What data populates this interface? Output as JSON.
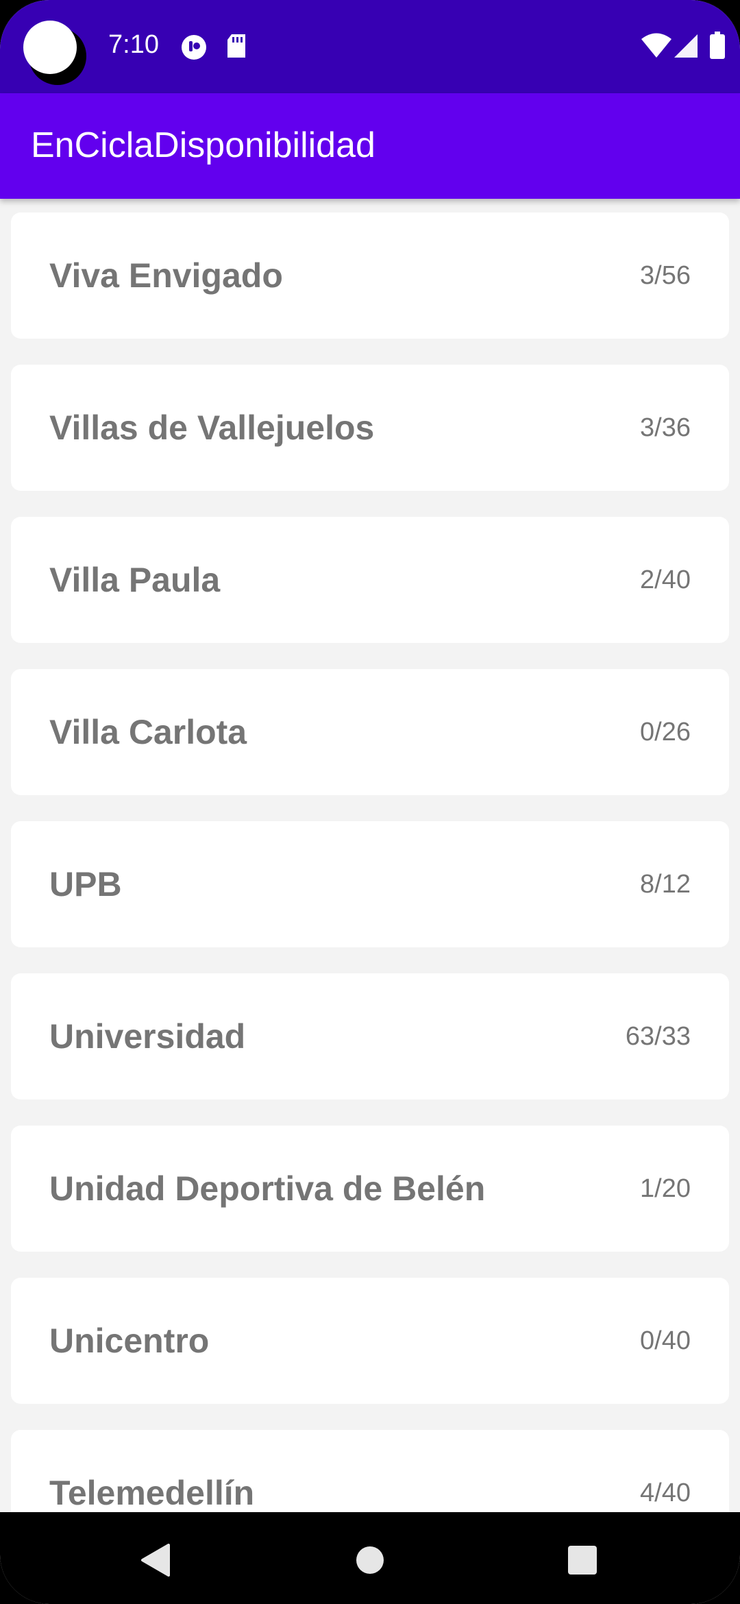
{
  "status_bar": {
    "time": "7:10",
    "icons": [
      "camera-cutout",
      "media-icon",
      "sd-card-icon",
      "wifi-icon",
      "cell-signal-icon",
      "battery-icon"
    ]
  },
  "app_bar": {
    "title": "EnCiclaDisponibilidad"
  },
  "stations": [
    {
      "name": "Viva Envigado",
      "count": "3/56"
    },
    {
      "name": "Villas de Vallejuelos",
      "count": "3/36"
    },
    {
      "name": "Villa Paula",
      "count": "2/40"
    },
    {
      "name": "Villa Carlota",
      "count": "0/26"
    },
    {
      "name": "UPB",
      "count": "8/12"
    },
    {
      "name": "Universidad",
      "count": "63/33"
    },
    {
      "name": "Unidad Deportiva de Belén",
      "count": "1/20"
    },
    {
      "name": "Unicentro",
      "count": "0/40"
    },
    {
      "name": "Telemedellín",
      "count": "4/40"
    }
  ],
  "nav_bar": {
    "buttons": [
      "back-icon",
      "home-icon",
      "recents-icon"
    ]
  },
  "colors": {
    "status_bar": "#3700b3",
    "app_bar": "#6200ee",
    "background": "#f3f3f3",
    "card": "#ffffff",
    "text": "#757575"
  }
}
